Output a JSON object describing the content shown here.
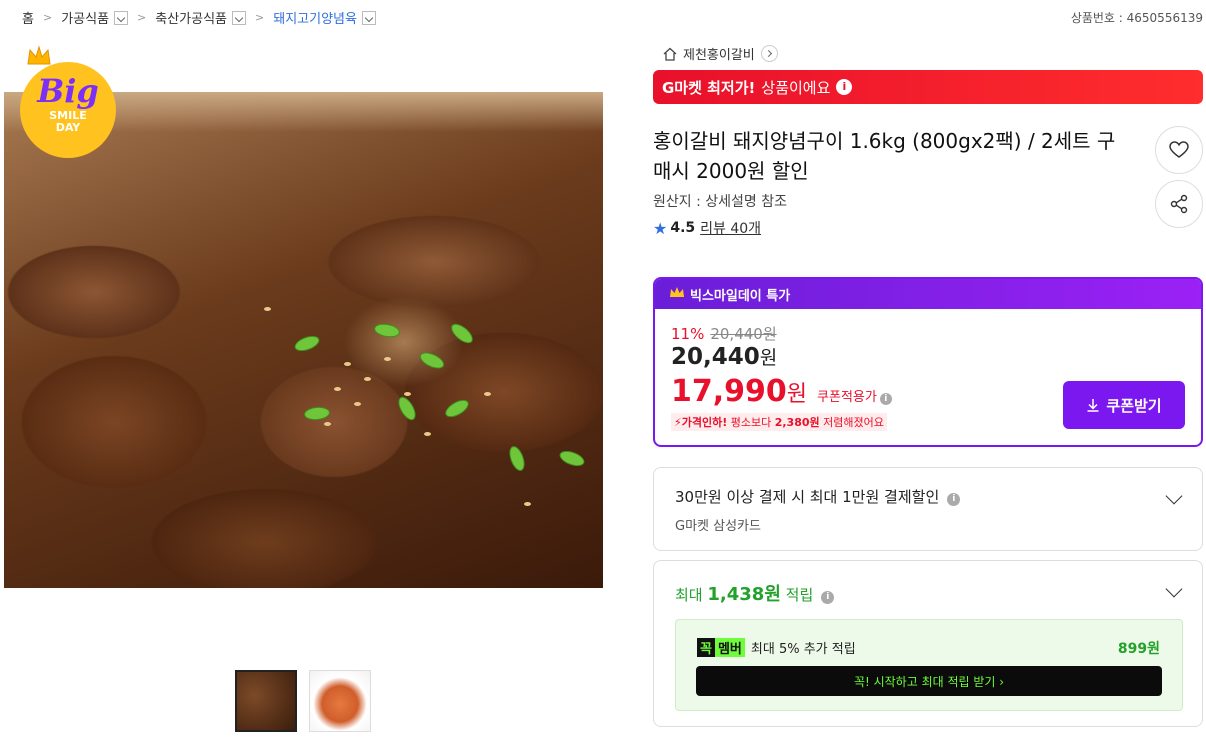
{
  "breadcrumb": {
    "items": [
      "홈",
      "가공식품",
      "축산가공식품",
      "돼지고기양념육"
    ],
    "separator": ">"
  },
  "product_number": "상품번호 : 4650556139",
  "badge": {
    "big": "Big",
    "line1": "SMILE",
    "line2": "DAY"
  },
  "shop": {
    "name": "제천홍이갈비"
  },
  "lowest_banner": {
    "bold": "G마켓 최저가!",
    "rest": "상품이에요",
    "info": "i"
  },
  "title": "홍이갈비 돼지양념구이 1.6kg (800gx2팩) / 2세트 구매시 2000원 할인",
  "origin": "원산지 : 상세설명 참조",
  "rating": {
    "score": "4.5",
    "reviews": "리뷰 40개"
  },
  "deal": {
    "header": "빅스마일데이 특가",
    "discount": "11%",
    "original_price": "20,440원",
    "price": "20,440",
    "price_unit": "원",
    "coupon_price": "17,990",
    "coupon_unit": "원",
    "coupon_label": "쿠폰적용가",
    "drop_bold": "가격인하!",
    "drop_text1": "평소보다",
    "drop_amount": "2,380원",
    "drop_text2": "저렴해졌어요",
    "coupon_button": "쿠폰받기"
  },
  "payment": {
    "title": "30만원 이상 결제 시 최대 1만원 결제할인",
    "card": "G마켓 삼성카드"
  },
  "points": {
    "prefix": "최대",
    "amount": "1,438원",
    "suffix": "적립",
    "member_tag_k": "꼭",
    "member_tag_m": "멤버",
    "member_text": "최대 5% 추가 적립",
    "member_amount": "899원",
    "member_button": "꼭! 시작하고 최대 적립 받기  ›"
  },
  "colors": {
    "accent_red": "#e8102b",
    "deal_purple": "#7b18f0",
    "points_green": "#22a22a",
    "link_blue": "#2f6fe0"
  },
  "icons": [
    "home-icon",
    "heart-icon",
    "share-icon",
    "star-icon",
    "crown-icon",
    "download-icon",
    "chevron-down-icon",
    "info-icon"
  ]
}
